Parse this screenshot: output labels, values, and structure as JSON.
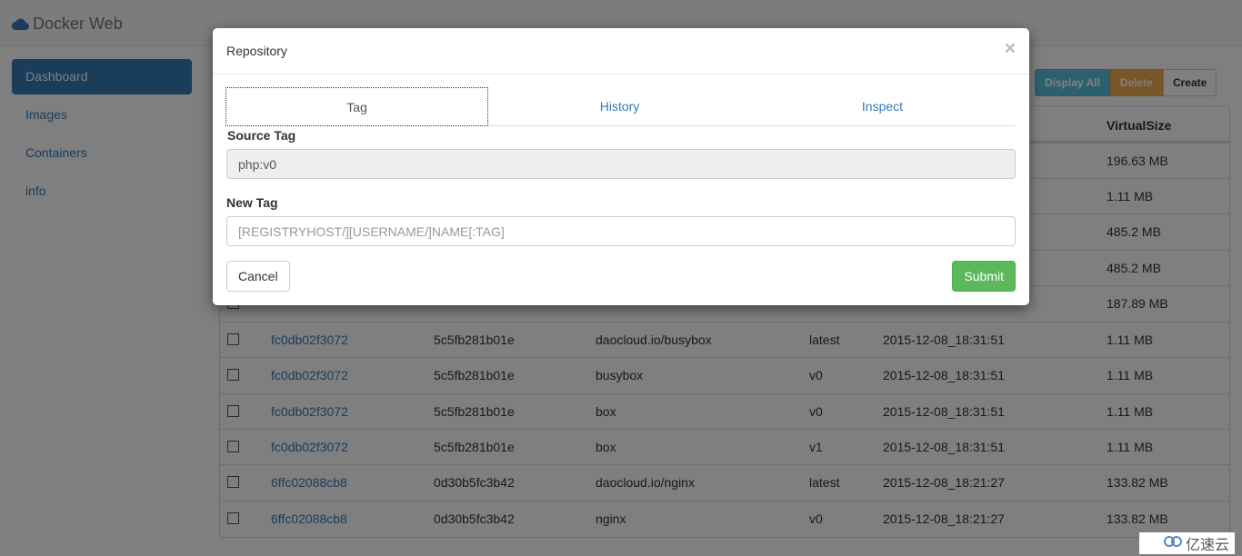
{
  "app": {
    "brand": "Docker Web"
  },
  "sidebar": {
    "items": [
      {
        "label": "Dashboard",
        "active": true
      },
      {
        "label": "Images"
      },
      {
        "label": "Containers"
      },
      {
        "label": "info"
      }
    ]
  },
  "toolbar": {
    "display_all": "Display All",
    "delete": "Delete",
    "create": "Create"
  },
  "table": {
    "size_header": "VirtualSize",
    "hidden_sizes": [
      "196.63 MB",
      "1.11 MB",
      "485.2 MB",
      "485.2 MB",
      "187.89 MB"
    ],
    "rows": [
      {
        "id": "fc0db02f3072",
        "parent": "5c5fb281b01e",
        "repo": "daocloud.io/busybox",
        "tag": "latest",
        "created": "2015-12-08_18:31:51",
        "size": "1.11 MB"
      },
      {
        "id": "fc0db02f3072",
        "parent": "5c5fb281b01e",
        "repo": "busybox",
        "tag": "v0",
        "created": "2015-12-08_18:31:51",
        "size": "1.11 MB"
      },
      {
        "id": "fc0db02f3072",
        "parent": "5c5fb281b01e",
        "repo": "box",
        "tag": "v0",
        "created": "2015-12-08_18:31:51",
        "size": "1.11 MB"
      },
      {
        "id": "fc0db02f3072",
        "parent": "5c5fb281b01e",
        "repo": "box",
        "tag": "v1",
        "created": "2015-12-08_18:31:51",
        "size": "1.11 MB"
      },
      {
        "id": "6ffc02088cb8",
        "parent": "0d30b5fc3b42",
        "repo": "daocloud.io/nginx",
        "tag": "latest",
        "created": "2015-12-08_18:21:27",
        "size": "133.82 MB"
      },
      {
        "id": "6ffc02088cb8",
        "parent": "0d30b5fc3b42",
        "repo": "nginx",
        "tag": "v0",
        "created": "2015-12-08_18:21:27",
        "size": "133.82 MB"
      }
    ]
  },
  "modal": {
    "title": "Repository",
    "close": "×",
    "tabs": [
      "Tag",
      "History",
      "Inspect"
    ],
    "source_label": "Source Tag",
    "source_value": "php:v0",
    "new_label": "New Tag",
    "new_placeholder": "[REGISTRYHOST/][USERNAME/]NAME[:TAG]",
    "cancel": "Cancel",
    "submit": "Submit"
  },
  "watermark": "亿速云",
  "colors": {
    "primary": "#337ab7",
    "success": "#5cb85c",
    "info": "#5bc0de",
    "warning": "#f0ad4e"
  }
}
